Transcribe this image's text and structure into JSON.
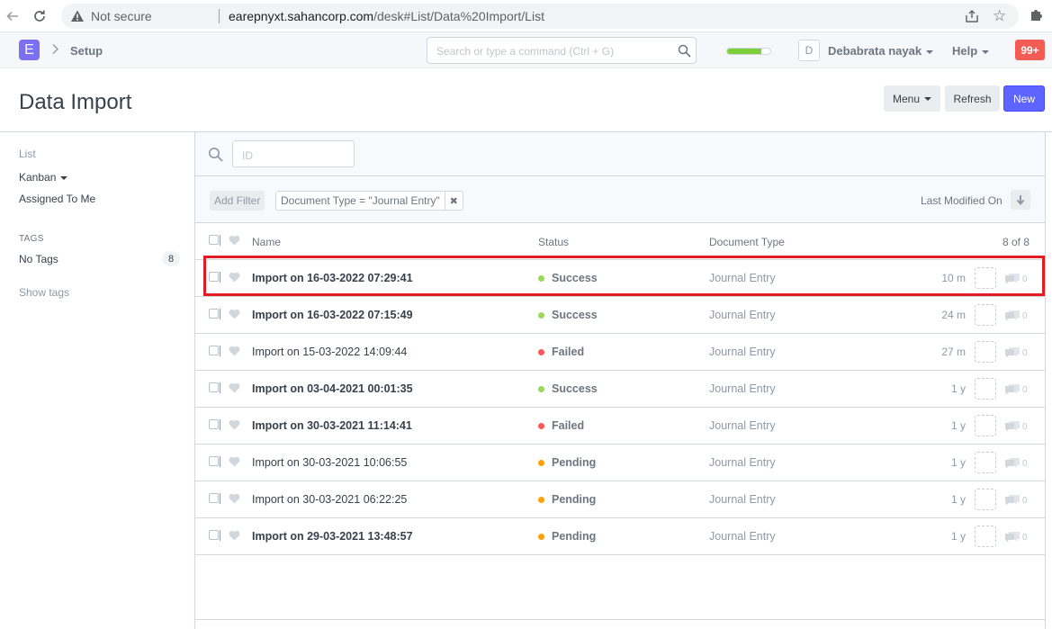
{
  "browser": {
    "security_label": "Not secure",
    "url_host": "earepnyxt.sahancorp.com",
    "url_path": "/desk#List/Data%20Import/List"
  },
  "navbar": {
    "logo_letter": "E",
    "breadcrumb": "Setup",
    "search_placeholder": "Search or type a command (Ctrl + G)",
    "setup_progress": 0.8,
    "avatar_letter": "D",
    "user_name": "Debabrata nayak",
    "help_label": "Help",
    "notifications": "99+"
  },
  "page": {
    "title": "Data Import",
    "menu_label": "Menu",
    "refresh_label": "Refresh",
    "new_label": "New"
  },
  "sidebar": {
    "list_label": "List",
    "kanban_label": "Kanban",
    "assigned_label": "Assigned To Me",
    "tags_title": "TAGS",
    "no_tags_label": "No Tags",
    "no_tags_count": "8",
    "show_tags_label": "Show tags"
  },
  "list": {
    "id_placeholder": "ID",
    "add_filter_label": "Add Filter",
    "filter_label": "Document Type = \"Journal Entry\"",
    "sort_label": "Last Modified On",
    "columns": {
      "name": "Name",
      "status": "Status",
      "doctype": "Document Type",
      "count": "8 of 8"
    },
    "status_colors": {
      "Success": "#98d85b",
      "Failed": "#ff5858",
      "Pending": "#ffa00a"
    },
    "highlight_color": "#e31b23",
    "rows": [
      {
        "name": "Import on 16-03-2022 07:29:41",
        "bold": true,
        "status": "Success",
        "doctype": "Journal Entry",
        "modified": "10 m",
        "comments": "0"
      },
      {
        "name": "Import on 16-03-2022 07:15:49",
        "bold": true,
        "status": "Success",
        "doctype": "Journal Entry",
        "modified": "24 m",
        "comments": "0"
      },
      {
        "name": "Import on 15-03-2022 14:09:44",
        "bold": false,
        "status": "Failed",
        "doctype": "Journal Entry",
        "modified": "27 m",
        "comments": "0"
      },
      {
        "name": "Import on 03-04-2021 00:01:35",
        "bold": true,
        "status": "Success",
        "doctype": "Journal Entry",
        "modified": "1 y",
        "comments": "0"
      },
      {
        "name": "Import on 30-03-2021 11:14:41",
        "bold": true,
        "status": "Failed",
        "doctype": "Journal Entry",
        "modified": "1 y",
        "comments": "0"
      },
      {
        "name": "Import on 30-03-2021 10:06:55",
        "bold": false,
        "status": "Pending",
        "doctype": "Journal Entry",
        "modified": "1 y",
        "comments": "0"
      },
      {
        "name": "Import on 30-03-2021 06:22:25",
        "bold": false,
        "status": "Pending",
        "doctype": "Journal Entry",
        "modified": "1 y",
        "comments": "0"
      },
      {
        "name": "Import on 29-03-2021 13:48:57",
        "bold": true,
        "status": "Pending",
        "doctype": "Journal Entry",
        "modified": "1 y",
        "comments": "0"
      }
    ]
  }
}
